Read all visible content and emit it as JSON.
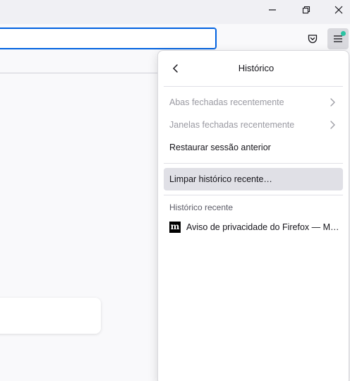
{
  "titlebar": {
    "icons": [
      "minimize-icon",
      "restore-icon",
      "close-icon"
    ]
  },
  "navbar": {
    "url_value": "",
    "icons": [
      "pocket-icon",
      "hamburger-menu-icon"
    ],
    "accent_color": "#0061e0",
    "badge_color": "#2ac3a2"
  },
  "panel": {
    "title": "Histórico",
    "back_icon": "chevron-left-icon",
    "items": {
      "recently_closed_tabs": "Abas fechadas recentemente",
      "recently_closed_windows": "Janelas fechadas recentemente",
      "restore_session": "Restaurar sessão anterior",
      "clear_recent_history": "Limpar histórico recente…"
    },
    "recent_section_label": "Histórico recente",
    "recent_history": [
      {
        "favicon": "m",
        "title": "Aviso de privacidade do Firefox — Moz…"
      }
    ]
  }
}
